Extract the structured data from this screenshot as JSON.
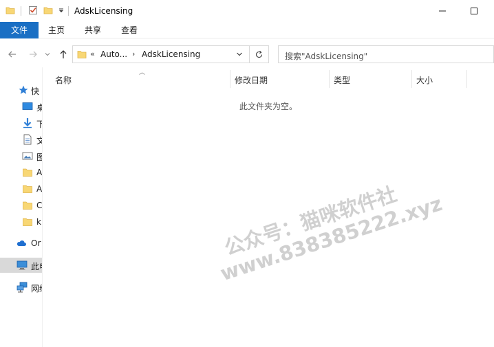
{
  "window": {
    "title": "AdskLicensing"
  },
  "ribbon": {
    "tabs": [
      {
        "label": "文件"
      },
      {
        "label": "主页"
      },
      {
        "label": "共享"
      },
      {
        "label": "查看"
      }
    ]
  },
  "address": {
    "overflow": "«",
    "crumbs": [
      "Auto...",
      "AdskLicensing"
    ]
  },
  "search": {
    "placeholder": "搜索\"AdskLicensing\""
  },
  "navpane": {
    "items": [
      {
        "label": "快",
        "icon": "star-icon"
      },
      {
        "label": "桌",
        "icon": "desktop-icon"
      },
      {
        "label": "下",
        "icon": "download-icon"
      },
      {
        "label": "文",
        "icon": "document-icon"
      },
      {
        "label": "图",
        "icon": "picture-icon"
      },
      {
        "label": "A",
        "icon": "folder-icon"
      },
      {
        "label": "A",
        "icon": "folder-icon"
      },
      {
        "label": "C",
        "icon": "folder-icon"
      },
      {
        "label": "k",
        "icon": "folder-icon"
      },
      {
        "label": "Or",
        "icon": "cloud-icon"
      },
      {
        "label": "此电",
        "icon": "computer-icon"
      },
      {
        "label": "网络",
        "icon": "network-icon"
      }
    ]
  },
  "columns": [
    {
      "label": "名称"
    },
    {
      "label": "修改日期"
    },
    {
      "label": "类型"
    },
    {
      "label": "大小"
    }
  ],
  "empty_message": "此文件夹为空。",
  "watermark": {
    "line1": "公众号：猫咪软件社",
    "line2": "www.838385222.xyz"
  },
  "colors": {
    "accent": "#1a6fc4",
    "folder": "#f8d775",
    "folder_dark": "#e8b84a"
  }
}
